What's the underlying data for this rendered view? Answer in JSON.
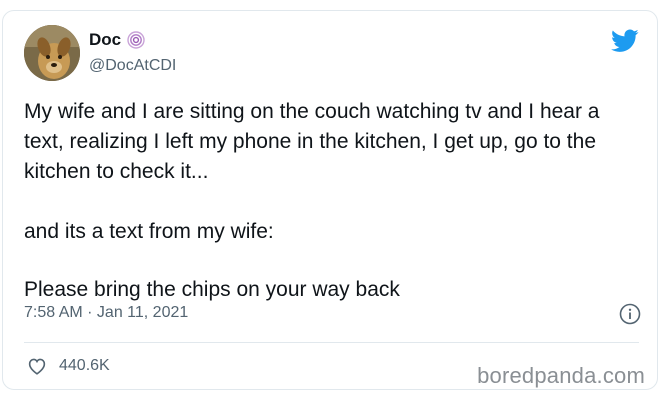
{
  "author": {
    "display_name": "Doc",
    "handle": "@DocAtCDI",
    "avatar": "dog-avatar"
  },
  "tweet": {
    "paragraph_1": "My wife and I are sitting on the couch watching tv and I hear a text, realizing I left my phone in the kitchen, I get up, go to the kitchen to check it...",
    "paragraph_2": "and its a text from my wife:",
    "paragraph_3": "Please bring the chips on your way back"
  },
  "meta": {
    "timestamp": "7:58 AM · Jan 11, 2021"
  },
  "engagement": {
    "likes": "440.6K"
  },
  "watermark": "boredpanda.com",
  "icons": {
    "brand": "twitter-bird-icon",
    "badge": "spiral-emoji-icon",
    "info": "info-icon",
    "like": "heart-icon"
  },
  "colors": {
    "twitter_blue": "#1d9bf0",
    "secondary_text": "#536471",
    "border": "#e1e8ed"
  }
}
